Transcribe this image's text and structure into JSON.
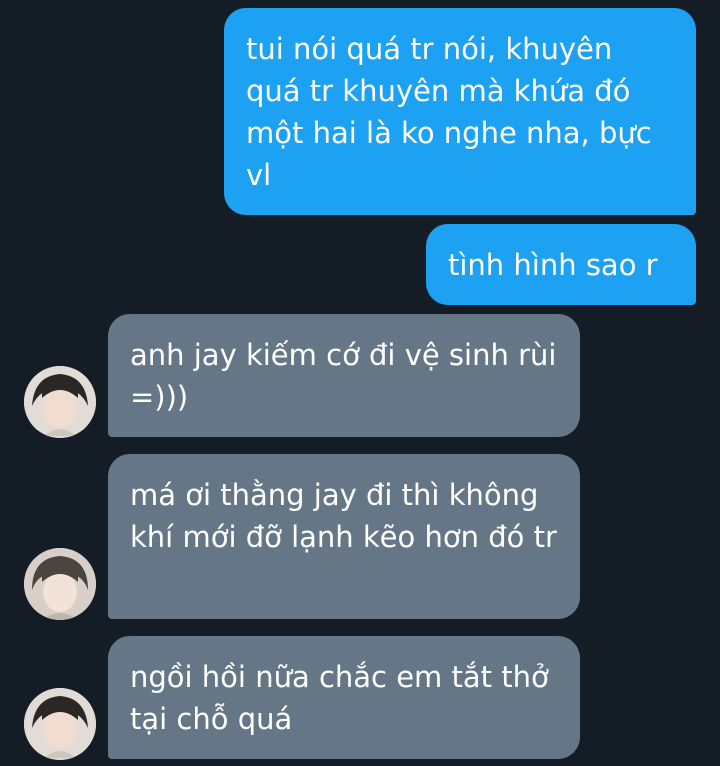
{
  "conversation": {
    "messages": [
      {
        "side": "out",
        "text": "tui nói quá tr nói, khuyên quá tr khuyên mà khứa đó một hai là ko nghe nha, bực vl"
      },
      {
        "side": "out",
        "text": "tình hình sao r"
      },
      {
        "side": "in",
        "text": "anh jay kiếm cớ đi vệ sinh rùi =)))",
        "avatar": "contact-avatar"
      },
      {
        "side": "in",
        "text": "má ơi thằng jay đi thì không khí mới đỡ lạnh kẽo hơn đó tr",
        "avatar": "contact-avatar"
      },
      {
        "side": "in",
        "text": "ngồi hồi nữa chắc em tắt thở tại chỗ quá",
        "avatar": "contact-avatar"
      }
    ]
  },
  "colors": {
    "background": "#141d26",
    "outgoing_bubble": "#1da1f2",
    "incoming_bubble": "#657786",
    "text": "#ffffff"
  }
}
